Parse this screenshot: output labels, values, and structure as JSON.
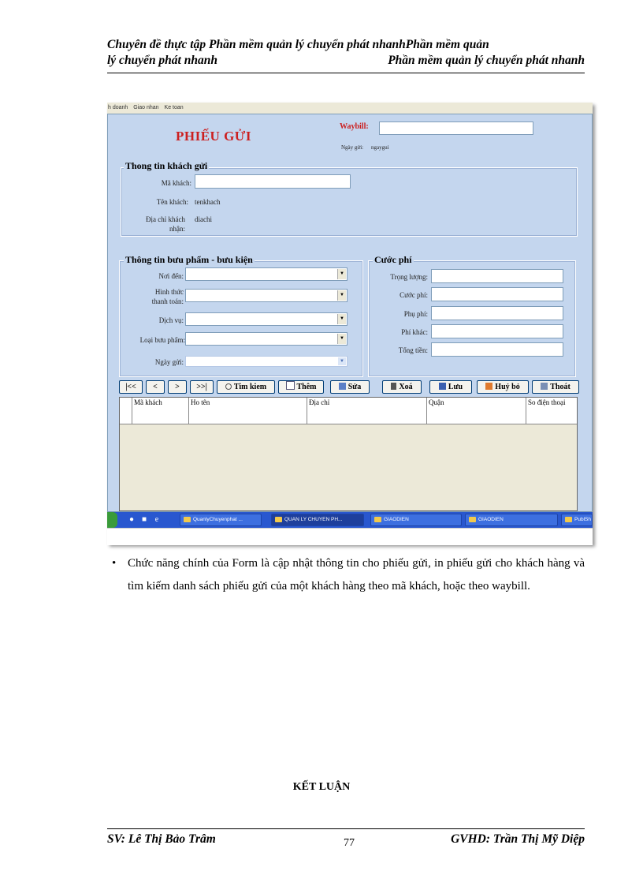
{
  "header": {
    "line1": "Chuyên đề thực tập Phần mềm quản lý chuyển phát nhanhPhần mềm quản",
    "line2_left": "lý chuyển phát nhanh",
    "line2_right": "Phần mềm quản lý chuyển phát nhanh"
  },
  "screenshot": {
    "menu": [
      "h doanh",
      "Giao nhan",
      "Ke toan"
    ],
    "form_title": "PHIẾU GỬI",
    "waybill_label": "Waybill:",
    "ngay_gui_label": "Ngày gửi:",
    "ngay_gui_value": "ngaygui",
    "customer_group": {
      "title": "Thong tin khách gửi",
      "ma_khach_label": "Mã khách:",
      "ten_khach_label": "Tên khách:",
      "ten_khach_value": "tenkhach",
      "dia_chi_label_1": "Địa chỉ khách",
      "dia_chi_label_2": "nhận:",
      "dia_chi_value": "diachi"
    },
    "parcel_group": {
      "title": "Thông tin bưu phẩm - bưu kiện",
      "noi_den": "Nơi đến:",
      "hinh_thuc_1": "Hình thức",
      "hinh_thuc_2": "thanh toán:",
      "dich_vu": "Dịch vụ:",
      "loai_buu_pham": "Loại bưu phẩm:",
      "ngay_gui": "Ngày gửi:"
    },
    "fee_group": {
      "title": "Cước phí",
      "trong_luong": "Trọng lượng:",
      "cuoc_phi": "Cước phí:",
      "phu_phi": "Phụ phí:",
      "phi_khac": "Phí khác:",
      "tong_tien": "Tổng tiền:"
    },
    "toolbar": {
      "first": "|<<",
      "prev": "<",
      "next": ">",
      "last": ">>|",
      "search": "Tim kiem",
      "add": "Thêm",
      "edit": "Sửa",
      "delete": "Xoá",
      "save": "Lưu",
      "cancel": "Huỷ bỏ",
      "exit": "Thoát"
    },
    "grid_columns": [
      "Mã khách",
      "Ho tên",
      "Địa chỉ",
      "Quận",
      "So điện thoại"
    ],
    "taskbar": [
      "QuanlyChuyenphat ...",
      "QUAN LY CHUYEN PH...",
      "GIAODIEN",
      "GIAODIEN",
      "PublSh"
    ]
  },
  "paragraph": "Chức năng chính của Form là cập nhật thông tin cho phiếu gửi, in phiếu gửi cho khách hàng và tìm kiếm danh sách phiếu gửi của một khách hàng theo mã khách, hoặc theo waybill.",
  "bullet": "•",
  "conclusion": "KẾT LUẬN",
  "footer": {
    "left": "SV: Lê Thị Bảo Trâm",
    "page": "77",
    "right": "GVHD: Trần Thị Mỹ Diệp"
  }
}
